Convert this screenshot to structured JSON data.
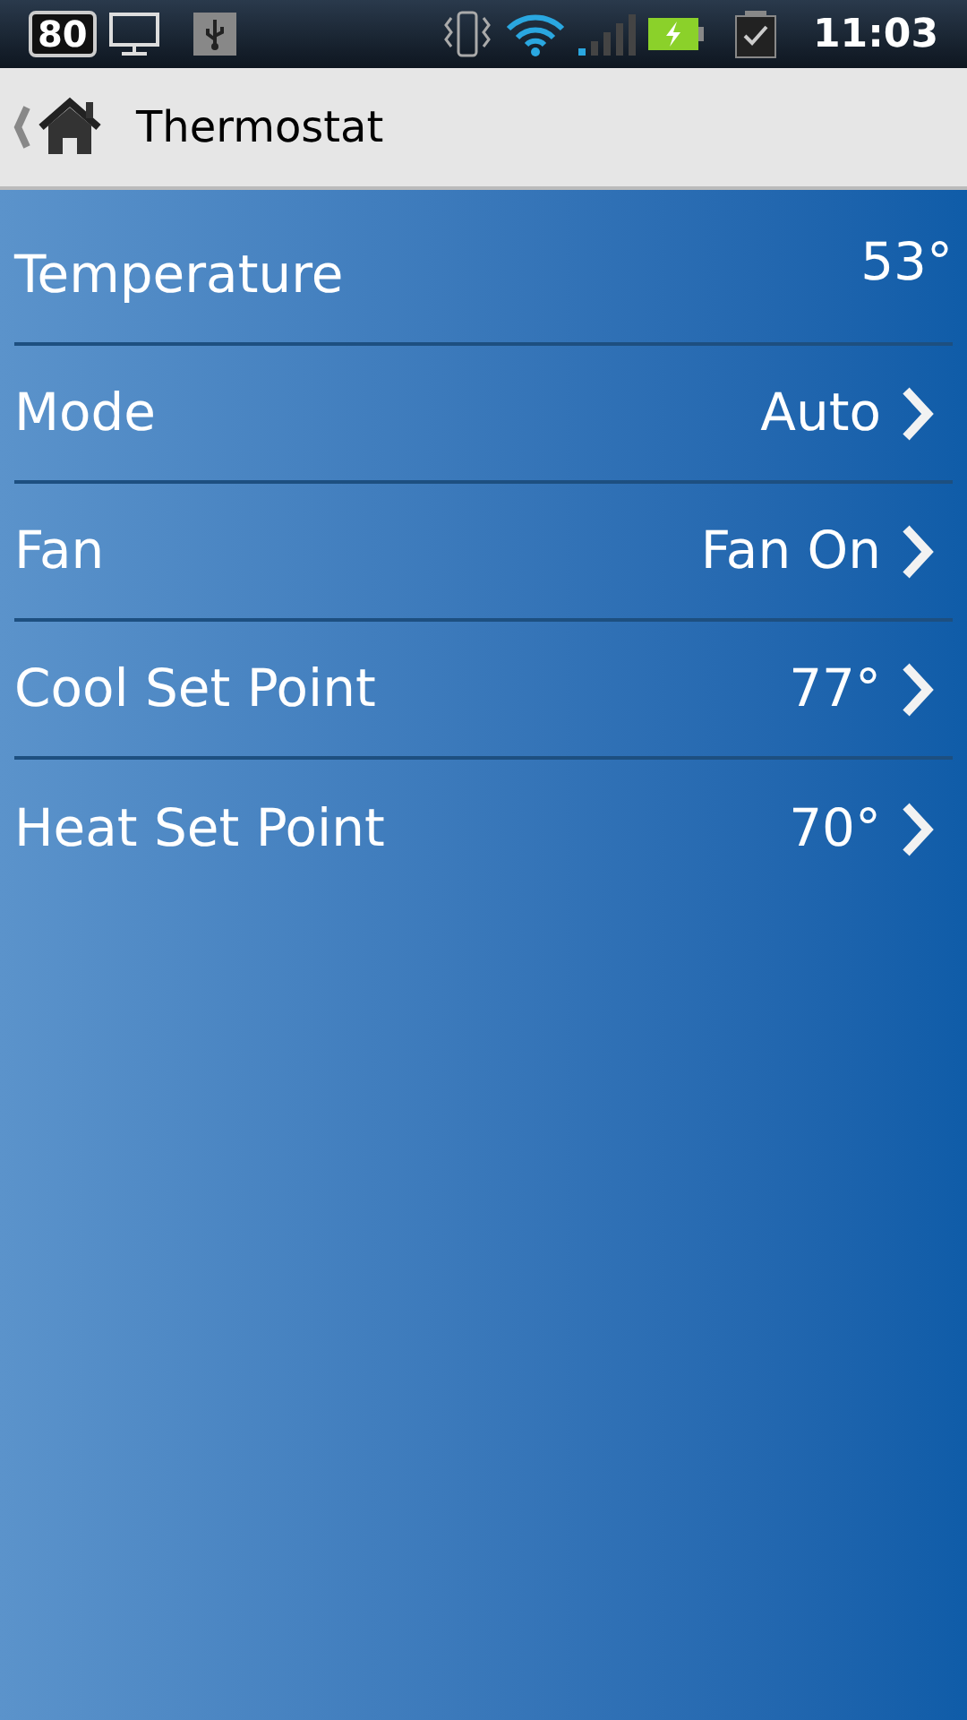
{
  "status_bar": {
    "battery_level_text": "80",
    "time": "11:03"
  },
  "action_bar": {
    "title": "Thermostat"
  },
  "rows": [
    {
      "label": "Temperature",
      "value": "53°",
      "chevron": false
    },
    {
      "label": "Mode",
      "value": "Auto",
      "chevron": true
    },
    {
      "label": "Fan",
      "value": "Fan On",
      "chevron": true
    },
    {
      "label": "Cool Set Point",
      "value": "77°",
      "chevron": true
    },
    {
      "label": "Heat Set Point",
      "value": "70°",
      "chevron": true
    }
  ]
}
